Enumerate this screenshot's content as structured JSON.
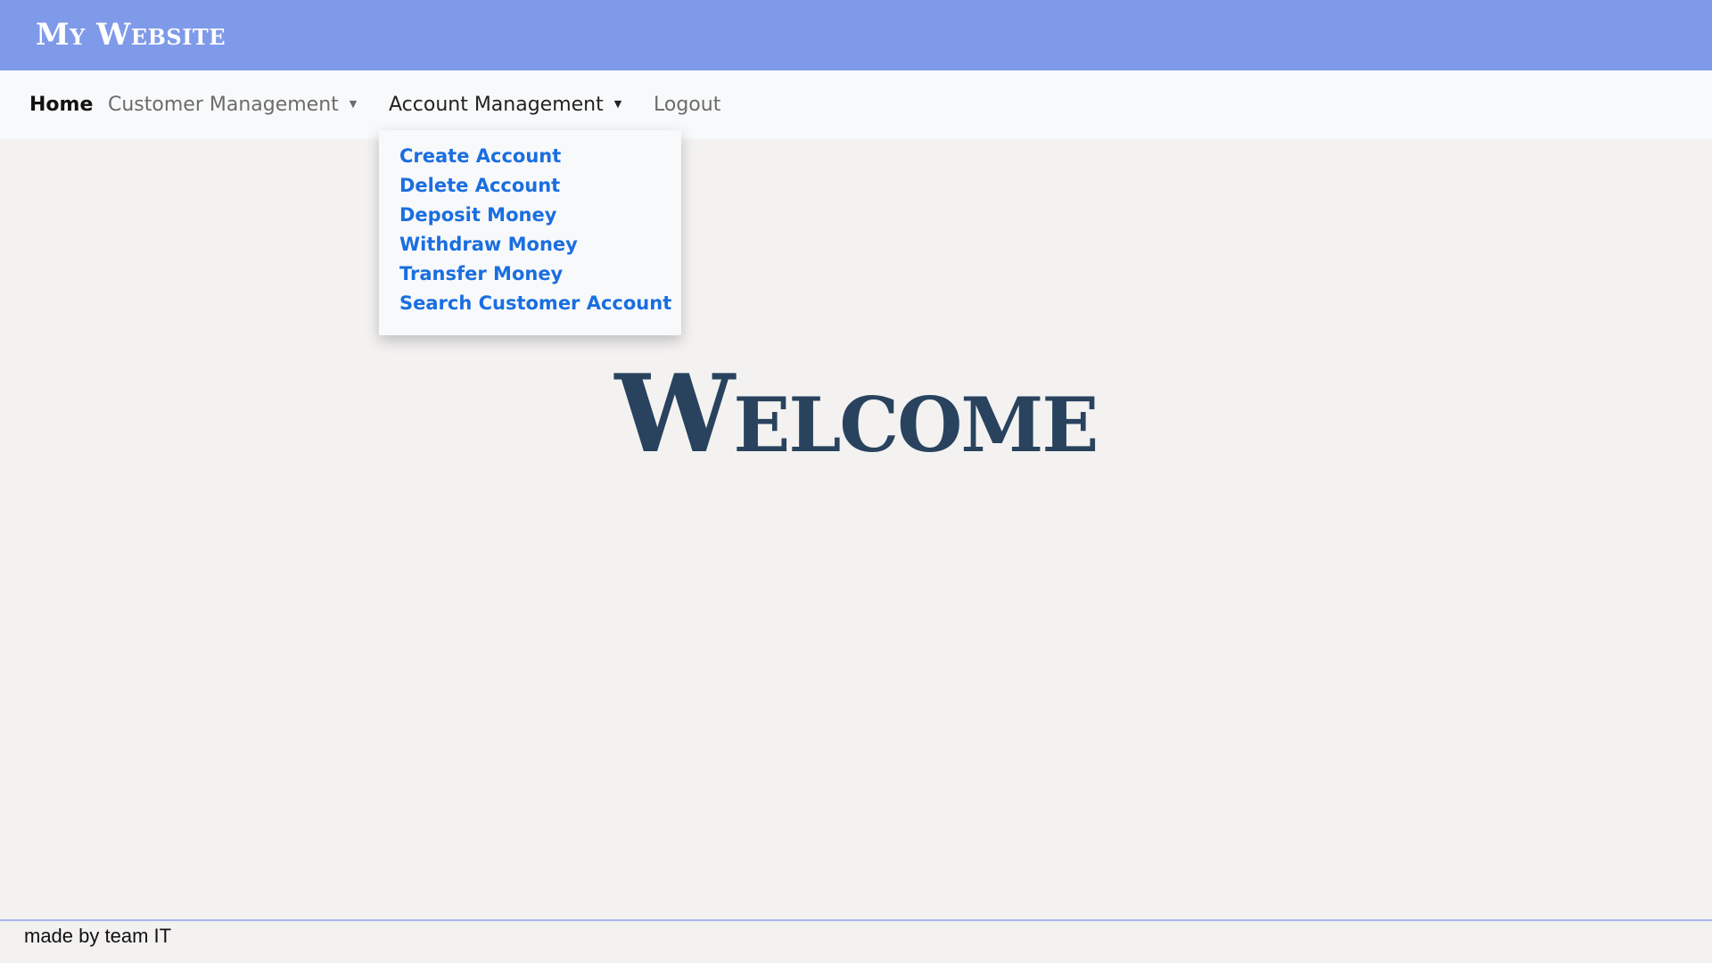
{
  "header": {
    "brand": "My Website",
    "background_color": "#7f9ae8"
  },
  "nav": {
    "items": [
      {
        "label": "Home",
        "state": "active"
      },
      {
        "label": "Customer Management",
        "has_dropdown": true
      },
      {
        "label": "Account Management",
        "has_dropdown": true,
        "state": "open"
      },
      {
        "label": "Logout"
      }
    ],
    "caret_icon": "caret-down-icon"
  },
  "account_dropdown": {
    "items": [
      {
        "label": "Create Account"
      },
      {
        "label": "Delete Account"
      },
      {
        "label": "Deposit Money"
      },
      {
        "label": "Withdraw Money"
      },
      {
        "label": "Transfer Money"
      },
      {
        "label": "Search Customer Account"
      }
    ],
    "link_color": "#1a6ee0"
  },
  "main": {
    "title": "Welcome",
    "title_color": "#29435e"
  },
  "footer": {
    "text": "made by team IT"
  }
}
